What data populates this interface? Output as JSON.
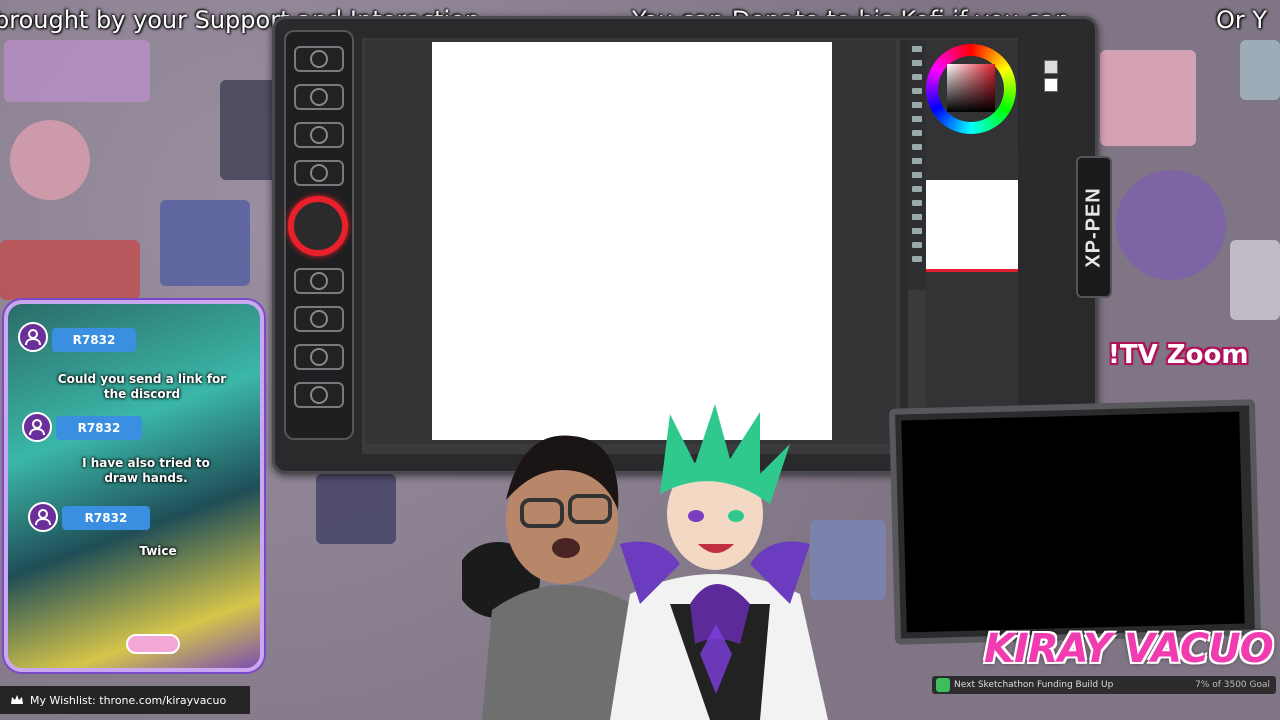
{
  "marquee": {
    "segment_1": "brought by your Support and Interaction.",
    "segment_2": "You can Donate to his Kofi if you can",
    "segment_3": "Or Y"
  },
  "tablet": {
    "brand": "XP-PEN",
    "hardware_keys": 8,
    "dial_color": "#e8202a"
  },
  "chat": {
    "messages": [
      {
        "user": "R7832",
        "text": "Could you send a link for the discord"
      },
      {
        "user": "R7832",
        "text": "I have also tried to draw hands."
      },
      {
        "user": "R7832",
        "text": "Twice"
      }
    ]
  },
  "overlay": {
    "tv_zoom": "!TV Zoom",
    "logo": "KIRAY VACUO",
    "goal_label": "Next Sketchathon Funding Build Up",
    "goal_progress": "7% of 3500 Goal",
    "wishlist": "My Wishlist: throne.com/kirayvacuo"
  },
  "icons": {
    "wishlist_icon": "crown-icon",
    "chat_avatar_icon": "user-icon",
    "goal_icon": "goal-icon"
  },
  "colors": {
    "accent_pink": "#f03cb0",
    "chat_name_blue": "#3a8fe0",
    "chat_border": "#c9a8f0"
  }
}
